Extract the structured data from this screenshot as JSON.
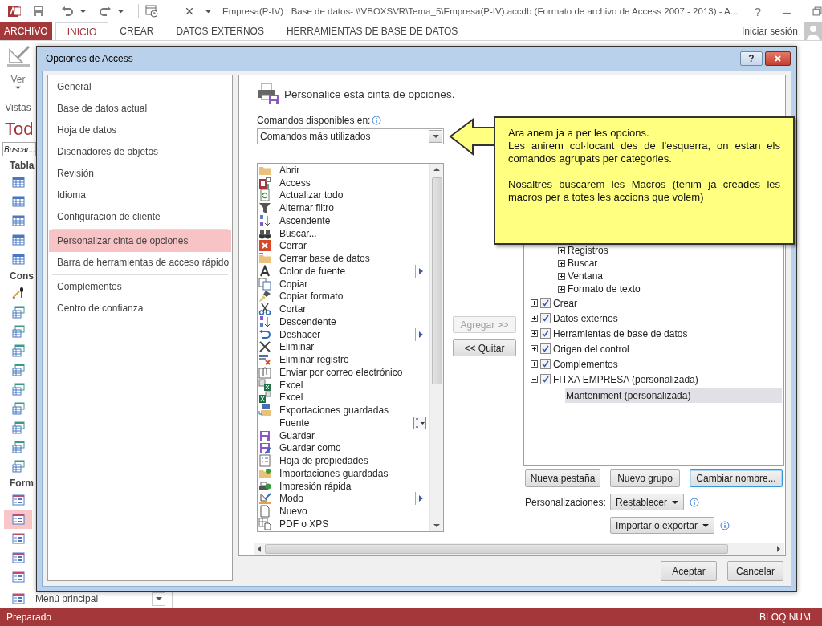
{
  "title_bar": {
    "title": "Empresa(P-IV) : Base de datos- \\\\VBOXSVR\\Tema_5\\Empresa(P-IV).accdb (Formato de archivo de Access 2007 - 2013) - A...",
    "help_glyph": "?"
  },
  "ribbon_tabs": [
    {
      "label": "ARCHIVO",
      "kind": "file",
      "selected": false
    },
    {
      "label": "INICIO",
      "kind": "tab",
      "selected": true
    },
    {
      "label": "CREAR",
      "kind": "tab",
      "selected": false
    },
    {
      "label": "DATOS EXTERNOS",
      "kind": "tab",
      "selected": false
    },
    {
      "label": "HERRAMIENTAS DE BASE DE DATOS",
      "kind": "tab",
      "selected": false
    }
  ],
  "account": {
    "label": "Iniciar sesión"
  },
  "ribbon": {
    "button": "Ver",
    "group": "Vistas"
  },
  "nav_pane": {
    "title": "Tod",
    "search": {
      "placeholder": "Buscar..."
    },
    "sections": [
      {
        "header": "Tabla",
        "items": [
          {
            "kind": "table",
            "selected": false
          },
          {
            "kind": "table",
            "selected": false
          },
          {
            "kind": "table",
            "selected": false
          },
          {
            "kind": "table",
            "selected": false
          },
          {
            "kind": "table",
            "selected": false
          }
        ]
      },
      {
        "header": "Cons",
        "items": [
          {
            "kind": "design",
            "selected": false
          },
          {
            "kind": "query",
            "selected": false
          },
          {
            "kind": "query",
            "selected": false
          },
          {
            "kind": "query",
            "selected": false
          },
          {
            "kind": "query",
            "selected": false
          },
          {
            "kind": "query",
            "selected": false
          },
          {
            "kind": "query",
            "selected": false
          },
          {
            "kind": "query",
            "selected": false
          },
          {
            "kind": "query",
            "selected": false
          },
          {
            "kind": "query",
            "selected": false
          }
        ]
      },
      {
        "header": "Form",
        "items": [
          {
            "kind": "form",
            "selected": false
          },
          {
            "kind": "form",
            "selected": true
          },
          {
            "kind": "form",
            "selected": false
          },
          {
            "kind": "form",
            "selected": false
          },
          {
            "kind": "form",
            "selected": false
          },
          {
            "kind": "form",
            "selected": false,
            "label": "Menú principal"
          }
        ]
      }
    ]
  },
  "status_bar": {
    "left": "Preparado",
    "right": "BLOQ NUM"
  },
  "dialog": {
    "title": "Opciones de Access",
    "help_glyph": "?",
    "category_groups": [
      [
        {
          "label": "General",
          "selected": false
        },
        {
          "label": "Base de datos actual",
          "selected": false
        },
        {
          "label": "Hoja de datos",
          "selected": false
        },
        {
          "label": "Diseñadores de objetos",
          "selected": false
        },
        {
          "label": "Revisión",
          "selected": false
        },
        {
          "label": "Idioma",
          "selected": false
        },
        {
          "label": "Configuración de cliente",
          "selected": false
        }
      ],
      [
        {
          "label": "Personalizar cinta de opciones",
          "selected": true
        },
        {
          "label": "Barra de herramientas de acceso rápido",
          "selected": false
        }
      ],
      [
        {
          "label": "Complementos",
          "selected": false
        },
        {
          "label": "Centro de confianza",
          "selected": false
        }
      ]
    ],
    "heading": "Personalice esta cinta de opciones.",
    "commands_label": "Comandos disponibles en:",
    "commands_dropdown": {
      "value": "Comandos más utilizados"
    },
    "commands": [
      {
        "label": "Abrir",
        "kind": "plain"
      },
      {
        "label": "Access",
        "kind": "plain"
      },
      {
        "label": "Actualizar todo",
        "kind": "plain"
      },
      {
        "label": "Alternar filtro",
        "kind": "plain"
      },
      {
        "label": "Ascendente",
        "kind": "plain"
      },
      {
        "label": "Buscar...",
        "kind": "plain"
      },
      {
        "label": "Cerrar",
        "kind": "plain"
      },
      {
        "label": "Cerrar base de datos",
        "kind": "plain"
      },
      {
        "label": "Color de fuente",
        "kind": "submenu"
      },
      {
        "label": "Copiar",
        "kind": "plain"
      },
      {
        "label": "Copiar formato",
        "kind": "plain"
      },
      {
        "label": "Cortar",
        "kind": "plain"
      },
      {
        "label": "Descendente",
        "kind": "plain"
      },
      {
        "label": "Deshacer",
        "kind": "submenu"
      },
      {
        "label": "Eliminar",
        "kind": "plain"
      },
      {
        "label": "Eliminar registro",
        "kind": "plain"
      },
      {
        "label": "Enviar por correo electrónico",
        "kind": "plain"
      },
      {
        "label": "Excel",
        "kind": "plain"
      },
      {
        "label": "Excel",
        "kind": "plain"
      },
      {
        "label": "Exportaciones guardadas",
        "kind": "plain"
      },
      {
        "label": "Fuente",
        "kind": "font_box"
      },
      {
        "label": "Guardar",
        "kind": "plain"
      },
      {
        "label": "Guardar como",
        "kind": "plain"
      },
      {
        "label": "Hoja de propiedades",
        "kind": "plain"
      },
      {
        "label": "Importaciones guardadas",
        "kind": "plain"
      },
      {
        "label": "Impresión rápida",
        "kind": "plain"
      },
      {
        "label": "Modo",
        "kind": "submenu"
      },
      {
        "label": "Nuevo",
        "kind": "plain"
      },
      {
        "label": "PDF o XPS",
        "kind": "plain"
      }
    ],
    "add_button": {
      "label": "Agregar >>",
      "disabled": true
    },
    "remove_button": {
      "label": "<< Quitar",
      "disabled": false
    },
    "ribbon_tree": [
      {
        "label": "Registros",
        "kind": "group",
        "expanded": false,
        "selected": false
      },
      {
        "label": "Buscar",
        "kind": "group",
        "expanded": false,
        "selected": false
      },
      {
        "label": "Ventana",
        "kind": "group",
        "expanded": false,
        "selected": false
      },
      {
        "label": "Formato de texto",
        "kind": "group",
        "expanded": false,
        "selected": false
      },
      {
        "label": "Crear",
        "kind": "tab",
        "checked": true,
        "expanded": false,
        "selected": false
      },
      {
        "label": "Datos externos",
        "kind": "tab",
        "checked": true,
        "expanded": false,
        "selected": false
      },
      {
        "label": "Herramientas de base de datos",
        "kind": "tab",
        "checked": true,
        "expanded": false,
        "selected": false
      },
      {
        "label": "Origen del control",
        "kind": "tab",
        "checked": true,
        "expanded": false,
        "selected": false
      },
      {
        "label": "Complementos",
        "kind": "tab",
        "checked": true,
        "expanded": false,
        "selected": false
      },
      {
        "label": "FITXA EMPRESA (personalizada)",
        "kind": "tab",
        "checked": true,
        "expanded": true,
        "selected": false,
        "children": [
          {
            "label": "Manteniment (personalizada)",
            "kind": "leaf",
            "selected": true
          }
        ]
      }
    ],
    "tree_buttons": [
      {
        "label": "Nueva pestaña",
        "focused": false
      },
      {
        "label": "Nuevo grupo",
        "focused": false
      },
      {
        "label": "Cambiar nombre...",
        "focused": true
      }
    ],
    "customizations_label": "Personalizaciones:",
    "customization_menus": [
      "Restablecer",
      "Importar o exportar"
    ],
    "footer_buttons": [
      "Aceptar",
      "Cancelar"
    ]
  },
  "callout": {
    "paragraphs": [
      [
        "Ara anem ja a per les opcions.",
        "Les anirem col·locant des de l'esquerra, on estan els comandos agrupats per categories."
      ],
      [
        "Nosaltres buscarem les Macros (tenim ja creades les macros per a totes les accions que volem)"
      ]
    ]
  }
}
